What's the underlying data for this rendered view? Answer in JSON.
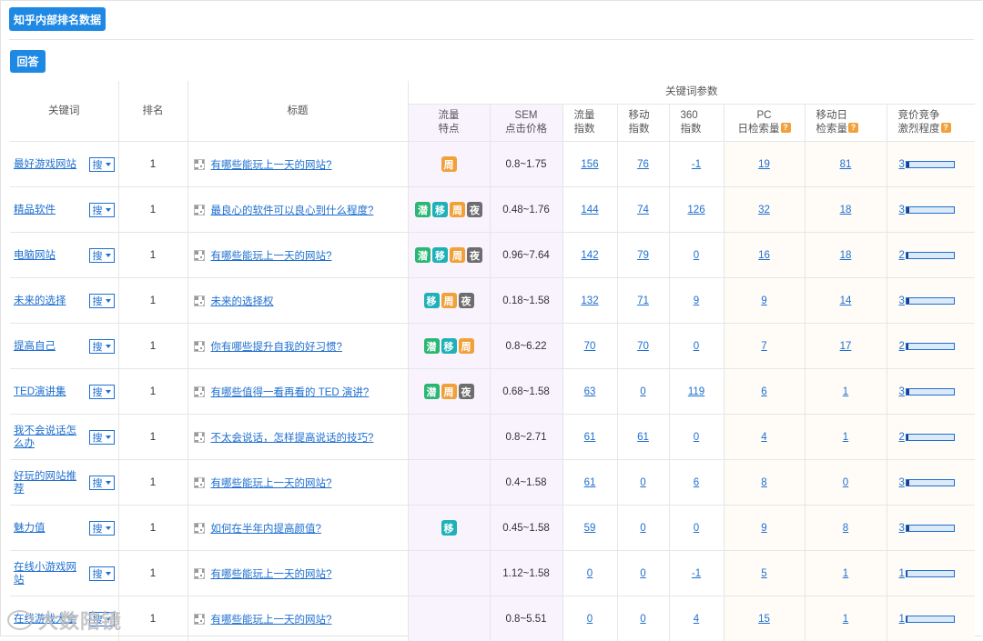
{
  "header": {
    "title_button": "知乎内部排名数据",
    "answer_button": "回答"
  },
  "table": {
    "columns": {
      "keyword": "关键词",
      "rank": "排名",
      "title": "标题",
      "group": "关键词参数",
      "feature_line1": "流量",
      "feature_line2": "特点",
      "sem_line1": "SEM",
      "sem_line2": "点击价格",
      "flow_line1": "流量",
      "flow_line2": "指数",
      "mobile_line1": "移动",
      "mobile_line2": "指数",
      "s360_line1": "360",
      "s360_line2": "指数",
      "pc_line1": "PC",
      "pc_line2": "日检索量",
      "md_line1": "移动日",
      "md_line2": "检索量",
      "comp_line1": "竞价竞争",
      "comp_line2": "激烈程度",
      "help_mark": "?"
    },
    "search_button_label": "搜",
    "rows": [
      {
        "keyword": "最好游戏网站",
        "rank": "1",
        "title": "有哪些能玩上一天的网站?",
        "badges": [
          "周"
        ],
        "sem": "0.8~1.75",
        "flow": "156",
        "mobile": "76",
        "s360": "-1",
        "pc": "19",
        "md": "81",
        "comp": "3",
        "comp_level": 0.05
      },
      {
        "keyword": "精品软件",
        "rank": "1",
        "title": "最良心的软件可以良心到什么程度?",
        "badges": [
          "潜",
          "移",
          "周",
          "夜"
        ],
        "sem": "0.48~1.76",
        "flow": "144",
        "mobile": "74",
        "s360": "126",
        "pc": "32",
        "md": "18",
        "comp": "3",
        "comp_level": 0.05
      },
      {
        "keyword": "电脑网站",
        "rank": "1",
        "title": "有哪些能玩上一天的网站?",
        "badges": [
          "潜",
          "移",
          "周",
          "夜"
        ],
        "sem": "0.96~7.64",
        "flow": "142",
        "mobile": "79",
        "s360": "0",
        "pc": "16",
        "md": "18",
        "comp": "2",
        "comp_level": 0.04
      },
      {
        "keyword": "未来的选择",
        "rank": "1",
        "title": "未来的选择权",
        "badges": [
          "移",
          "周",
          "夜"
        ],
        "sem": "0.18~1.58",
        "flow": "132",
        "mobile": "71",
        "s360": "9",
        "pc": "9",
        "md": "14",
        "comp": "3",
        "comp_level": 0.05
      },
      {
        "keyword": "提高自己",
        "rank": "1",
        "title": "你有哪些提升自我的好习惯?",
        "badges": [
          "潜",
          "移",
          "周"
        ],
        "sem": "0.8~6.22",
        "flow": "70",
        "mobile": "70",
        "s360": "0",
        "pc": "7",
        "md": "17",
        "comp": "2",
        "comp_level": 0.04
      },
      {
        "keyword": "TED演讲集",
        "rank": "1",
        "title": "有哪些值得一看再看的 TED 演讲?",
        "badges": [
          "潜",
          "周",
          "夜"
        ],
        "sem": "0.68~1.58",
        "flow": "63",
        "mobile": "0",
        "s360": "119",
        "pc": "6",
        "md": "1",
        "comp": "3",
        "comp_level": 0.05
      },
      {
        "keyword": "我不会说话怎么办",
        "rank": "1",
        "title": "不太会说话，怎样提高说话的技巧?",
        "badges": [],
        "sem": "0.8~2.71",
        "flow": "61",
        "mobile": "61",
        "s360": "0",
        "pc": "4",
        "md": "1",
        "comp": "2",
        "comp_level": 0.04
      },
      {
        "keyword": "好玩的网站推荐",
        "rank": "1",
        "title": "有哪些能玩上一天的网站?",
        "badges": [],
        "sem": "0.4~1.58",
        "flow": "61",
        "mobile": "0",
        "s360": "6",
        "pc": "8",
        "md": "0",
        "comp": "3",
        "comp_level": 0.05
      },
      {
        "keyword": "魅力值",
        "rank": "1",
        "title": "如何在半年内提高颜值?",
        "badges": [
          "移"
        ],
        "sem": "0.45~1.58",
        "flow": "59",
        "mobile": "0",
        "s360": "0",
        "pc": "9",
        "md": "8",
        "comp": "3",
        "comp_level": 0.05
      },
      {
        "keyword": "在线小游戏网站",
        "rank": "1",
        "title": "有哪些能玩上一天的网站?",
        "badges": [],
        "sem": "1.12~1.58",
        "flow": "0",
        "mobile": "0",
        "s360": "-1",
        "pc": "5",
        "md": "1",
        "comp": "1",
        "comp_level": 0.03
      },
      {
        "keyword": "在线游戏大全",
        "rank": "1",
        "title": "有哪些能玩上一天的网站?",
        "badges": [],
        "sem": "0.8~5.51",
        "flow": "0",
        "mobile": "0",
        "s360": "4",
        "pc": "15",
        "md": "1",
        "comp": "1",
        "comp_level": 0.03
      }
    ]
  },
  "watermark": {
    "text": "大数陪镜"
  },
  "colors": {
    "accent": "#1e88e5",
    "link": "#1e6fd0",
    "badge_qian": "#2bb673",
    "badge_yi": "#1fb1b8",
    "badge_zhou": "#f0a13a",
    "badge_ye": "#6d6d6d"
  }
}
